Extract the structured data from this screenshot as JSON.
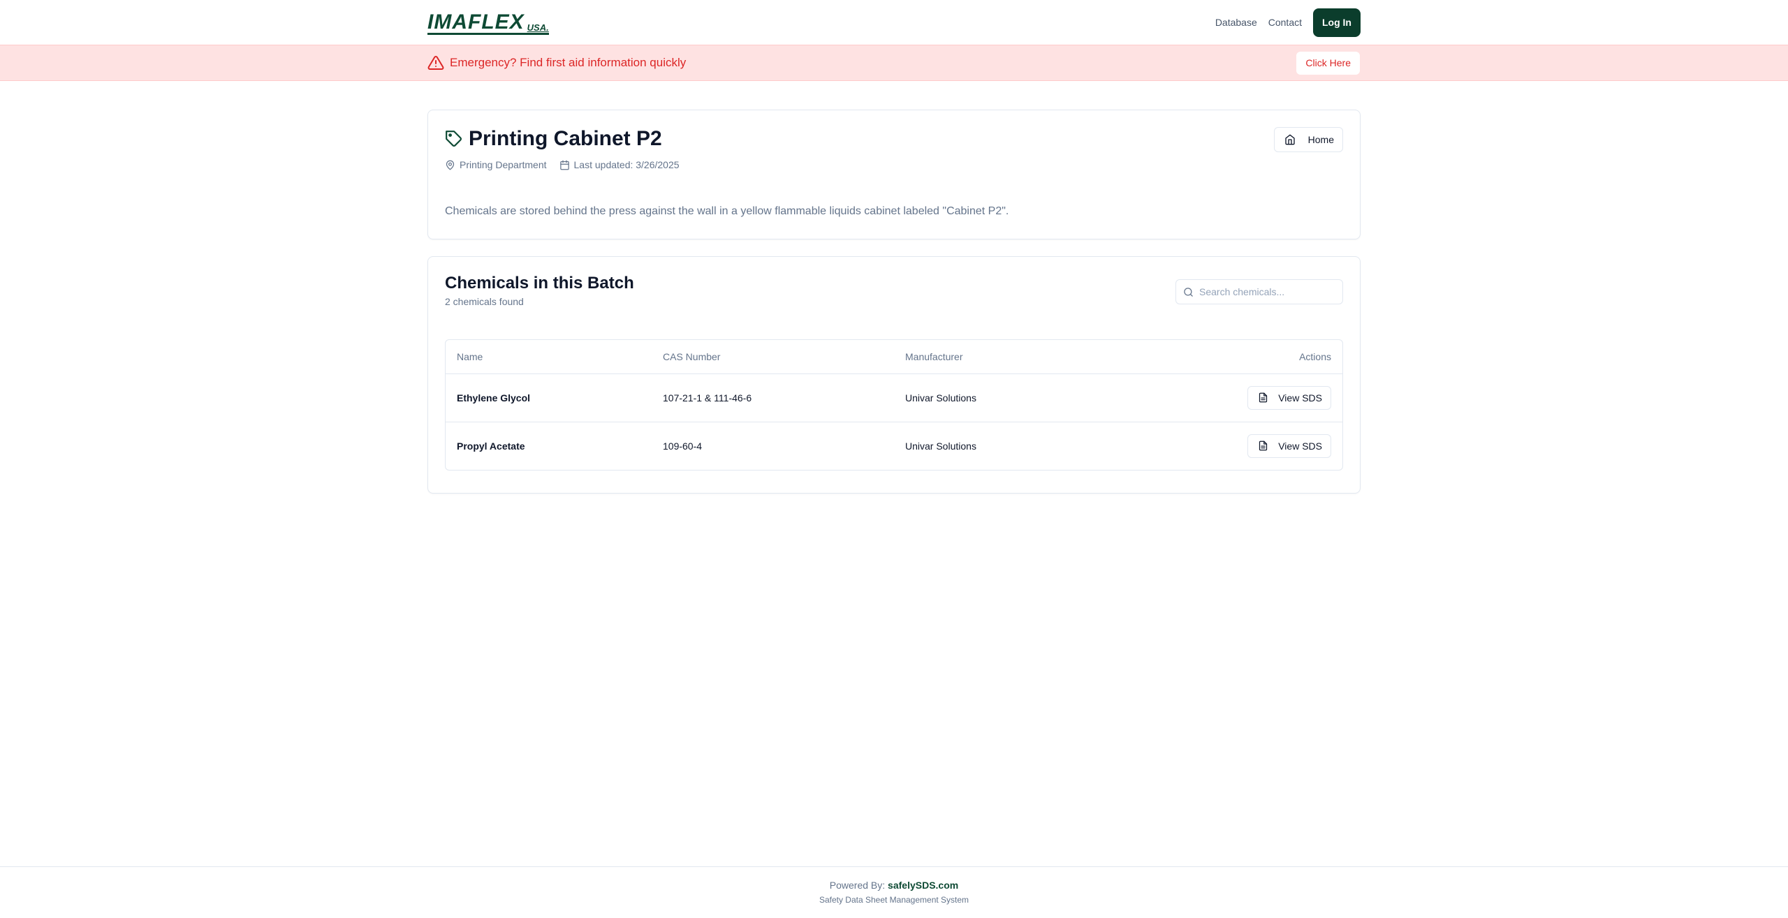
{
  "header": {
    "logo_main": "IMAFLEX",
    "logo_sub": "USA.",
    "nav": [
      "Database",
      "Contact"
    ],
    "login_label": "Log In"
  },
  "emergency": {
    "text": "Emergency? Find first aid information quickly",
    "button_label": "Click Here"
  },
  "location": {
    "title": "Printing Cabinet P2",
    "department": "Printing Department",
    "last_updated": "Last updated: 3/26/2025",
    "description": "Chemicals are stored behind the press against the wall in a yellow flammable liquids cabinet labeled \"Cabinet P2\".",
    "home_label": "Home"
  },
  "chemicals": {
    "title": "Chemicals in this Batch",
    "count": "2 chemicals found",
    "search_placeholder": "Search chemicals...",
    "columns": [
      "Name",
      "CAS Number",
      "Manufacturer",
      "Actions"
    ],
    "rows": [
      {
        "name": "Ethylene Glycol",
        "cas": "107-21-1 & 111-46-6",
        "manufacturer": "Univar Solutions",
        "action": "View SDS"
      },
      {
        "name": "Propyl Acetate",
        "cas": "109-60-4",
        "manufacturer": "Univar Solutions",
        "action": "View SDS"
      }
    ]
  },
  "footer": {
    "powered_prefix": "Powered By:",
    "powered_link": "safelySDS.com",
    "subtitle": "Safety Data Sheet Management System"
  },
  "colors": {
    "brand": "#0b3d2c",
    "emergency_bg": "#fee2e2",
    "emergency_text": "#dc2626"
  },
  "icons": [
    "alert-triangle-icon",
    "tag-icon",
    "map-pin-icon",
    "calendar-icon",
    "home-icon",
    "search-icon",
    "file-text-icon"
  ]
}
